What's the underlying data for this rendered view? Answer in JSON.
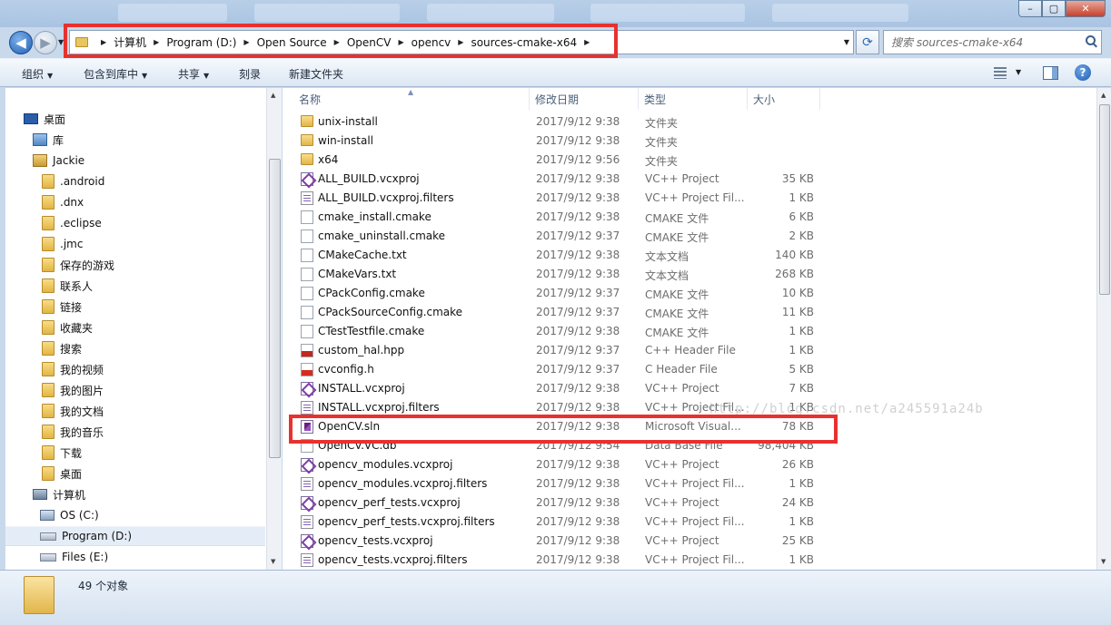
{
  "window": {
    "minimize_label": "–",
    "maximize_label": "▢",
    "close_label": "✕"
  },
  "address": {
    "crumbs": [
      "计算机",
      "Program (D:)",
      "Open Source",
      "OpenCV",
      "opencv",
      "sources-cmake-x64"
    ],
    "search_placeholder": "搜索 sources-cmake-x64"
  },
  "toolbar": {
    "organize": "组织",
    "include_in_library": "包含到库中",
    "share": "共享",
    "burn": "刻录",
    "new_folder": "新建文件夹"
  },
  "nav": {
    "items": [
      {
        "label": "桌面",
        "icon": "desktop-icon"
      },
      {
        "label": "库",
        "icon": "library-icon"
      },
      {
        "label": "Jackie",
        "icon": "user-folder-icon"
      },
      {
        "label": ".android",
        "icon": "folder-icon"
      },
      {
        "label": ".dnx",
        "icon": "folder-icon"
      },
      {
        "label": ".eclipse",
        "icon": "folder-icon"
      },
      {
        "label": ".jmc",
        "icon": "folder-icon"
      },
      {
        "label": "保存的游戏",
        "icon": "saved-games-icon"
      },
      {
        "label": "联系人",
        "icon": "contacts-icon"
      },
      {
        "label": "链接",
        "icon": "links-icon"
      },
      {
        "label": "收藏夹",
        "icon": "favorites-icon"
      },
      {
        "label": "搜索",
        "icon": "searches-icon"
      },
      {
        "label": "我的视频",
        "icon": "videos-icon"
      },
      {
        "label": "我的图片",
        "icon": "pictures-icon"
      },
      {
        "label": "我的文档",
        "icon": "documents-icon"
      },
      {
        "label": "我的音乐",
        "icon": "music-icon"
      },
      {
        "label": "下载",
        "icon": "downloads-icon"
      },
      {
        "label": "桌面",
        "icon": "desktop-folder-icon"
      },
      {
        "label": "计算机",
        "icon": "computer-icon"
      },
      {
        "label": "OS (C:)",
        "icon": "os-drive-icon"
      },
      {
        "label": "Program (D:)",
        "icon": "drive-icon"
      },
      {
        "label": "Files (E:)",
        "icon": "drive-icon"
      }
    ]
  },
  "columns": {
    "name": "名称",
    "date": "修改日期",
    "type": "类型",
    "size": "大小"
  },
  "files": [
    {
      "name": "unix-install",
      "date": "2017/9/12 9:38",
      "type": "文件夹",
      "size": "",
      "icon": "folder"
    },
    {
      "name": "win-install",
      "date": "2017/9/12 9:38",
      "type": "文件夹",
      "size": "",
      "icon": "folder"
    },
    {
      "name": "x64",
      "date": "2017/9/12 9:56",
      "type": "文件夹",
      "size": "",
      "icon": "folder"
    },
    {
      "name": "ALL_BUILD.vcxproj",
      "date": "2017/9/12 9:38",
      "type": "VC++ Project",
      "size": "35 KB",
      "icon": "proj"
    },
    {
      "name": "ALL_BUILD.vcxproj.filters",
      "date": "2017/9/12 9:38",
      "type": "VC++ Project Fil...",
      "size": "1 KB",
      "icon": "filt"
    },
    {
      "name": "cmake_install.cmake",
      "date": "2017/9/12 9:38",
      "type": "CMAKE 文件",
      "size": "6 KB",
      "icon": "doc"
    },
    {
      "name": "cmake_uninstall.cmake",
      "date": "2017/9/12 9:37",
      "type": "CMAKE 文件",
      "size": "2 KB",
      "icon": "doc"
    },
    {
      "name": "CMakeCache.txt",
      "date": "2017/9/12 9:38",
      "type": "文本文档",
      "size": "140 KB",
      "icon": "doc"
    },
    {
      "name": "CMakeVars.txt",
      "date": "2017/9/12 9:38",
      "type": "文本文档",
      "size": "268 KB",
      "icon": "doc"
    },
    {
      "name": "CPackConfig.cmake",
      "date": "2017/9/12 9:37",
      "type": "CMAKE 文件",
      "size": "10 KB",
      "icon": "doc"
    },
    {
      "name": "CPackSourceConfig.cmake",
      "date": "2017/9/12 9:37",
      "type": "CMAKE 文件",
      "size": "11 KB",
      "icon": "doc"
    },
    {
      "name": "CTestTestfile.cmake",
      "date": "2017/9/12 9:38",
      "type": "CMAKE 文件",
      "size": "1 KB",
      "icon": "doc"
    },
    {
      "name": "custom_hal.hpp",
      "date": "2017/9/12 9:37",
      "type": "C++ Header File",
      "size": "1 KB",
      "icon": "hpp"
    },
    {
      "name": "cvconfig.h",
      "date": "2017/9/12 9:37",
      "type": "C Header File",
      "size": "5 KB",
      "icon": "h"
    },
    {
      "name": "INSTALL.vcxproj",
      "date": "2017/9/12 9:38",
      "type": "VC++ Project",
      "size": "7 KB",
      "icon": "proj"
    },
    {
      "name": "INSTALL.vcxproj.filters",
      "date": "2017/9/12 9:38",
      "type": "VC++ Project Fil...",
      "size": "1 KB",
      "icon": "filt"
    },
    {
      "name": "OpenCV.sln",
      "date": "2017/9/12 9:38",
      "type": "Microsoft Visual...",
      "size": "78 KB",
      "icon": "sln"
    },
    {
      "name": "OpenCV.VC.db",
      "date": "2017/9/12 9:54",
      "type": "Data Base File",
      "size": "98,404 KB",
      "icon": "db"
    },
    {
      "name": "opencv_modules.vcxproj",
      "date": "2017/9/12 9:38",
      "type": "VC++ Project",
      "size": "26 KB",
      "icon": "proj"
    },
    {
      "name": "opencv_modules.vcxproj.filters",
      "date": "2017/9/12 9:38",
      "type": "VC++ Project Fil...",
      "size": "1 KB",
      "icon": "filt"
    },
    {
      "name": "opencv_perf_tests.vcxproj",
      "date": "2017/9/12 9:38",
      "type": "VC++ Project",
      "size": "24 KB",
      "icon": "proj"
    },
    {
      "name": "opencv_perf_tests.vcxproj.filters",
      "date": "2017/9/12 9:38",
      "type": "VC++ Project Fil...",
      "size": "1 KB",
      "icon": "filt"
    },
    {
      "name": "opencv_tests.vcxproj",
      "date": "2017/9/12 9:38",
      "type": "VC++ Project",
      "size": "25 KB",
      "icon": "proj"
    },
    {
      "name": "opencv_tests.vcxproj.filters",
      "date": "2017/9/12 9:38",
      "type": "VC++ Project Fil...",
      "size": "1 KB",
      "icon": "filt"
    }
  ],
  "watermark": "http://blog.csdn.net/a245591a24b",
  "status": {
    "count": "49 个对象"
  },
  "colors": {
    "highlight_box": "#e8312e",
    "toolbar_bg": "#dce7f4"
  }
}
